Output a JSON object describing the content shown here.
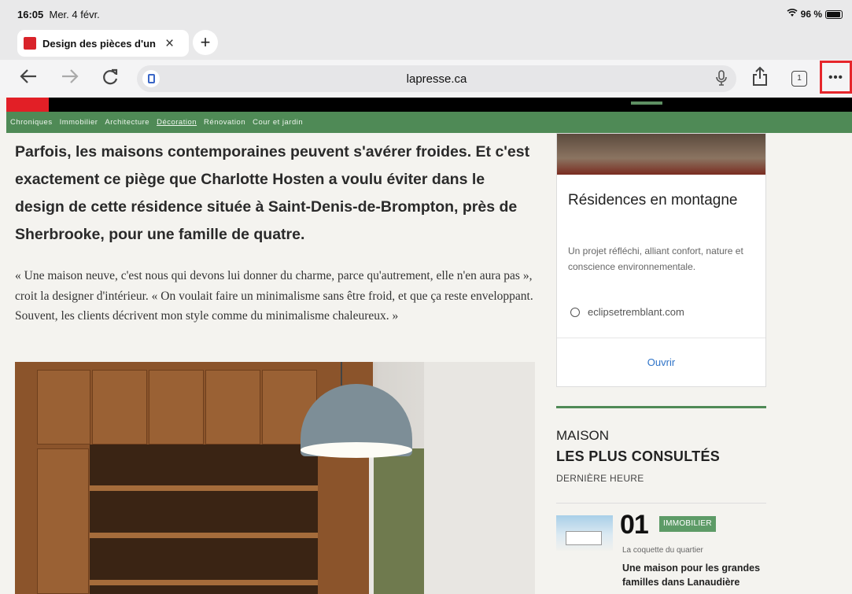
{
  "status": {
    "time": "16:05",
    "date": "Mer. 4 févr.",
    "battery": "96 %",
    "battery_level": 0.96
  },
  "tab": {
    "title": "Design des pièces d'un"
  },
  "toolbar": {
    "url": "lapresse.ca",
    "tabs_count": "1"
  },
  "nav": {
    "items": [
      "Chroniques",
      "Immobilier",
      "Architecture",
      "Décoration",
      "Rénovation",
      "Cour et jardin"
    ],
    "active": "Décoration"
  },
  "article": {
    "lead": "Parfois, les maisons contemporaines peuvent s'avérer froides. Et c'est exactement ce piège que Charlotte Hosten a voulu éviter dans le design de cette résidence située à Saint-Denis-de-Brompton, près de Sherbrooke, pour une famille de quatre.",
    "body": "« Une maison neuve, c'est nous qui devons lui donner du charme, parce qu'autrement, elle n'en aura pas », croit la designer d'intérieur. « On voulait faire un minimalisme sans être froid, et que ça reste enveloppant. Souvent, les clients décrivent mon style comme du minimalisme chaleureux. »"
  },
  "ad": {
    "title": "Résidences en montagne",
    "description": "Un projet réfléchi, alliant confort, nature et conscience environnementale.",
    "domain": "eclipsetremblant.com",
    "cta": "Ouvrir"
  },
  "most_read": {
    "section": "MAISON",
    "title": "LES PLUS CONSULTÉS",
    "subtitle": "DERNIÈRE HEURE",
    "items": [
      {
        "number": "01",
        "badge": "IMMOBILIER",
        "kicker": "La coquette du quartier",
        "headline": "Une maison pour les grandes familles dans Lanaudière"
      }
    ]
  },
  "colors": {
    "accent_green": "#4f8a56",
    "brand_red": "#e21f26",
    "highlight": "#e6262b"
  }
}
